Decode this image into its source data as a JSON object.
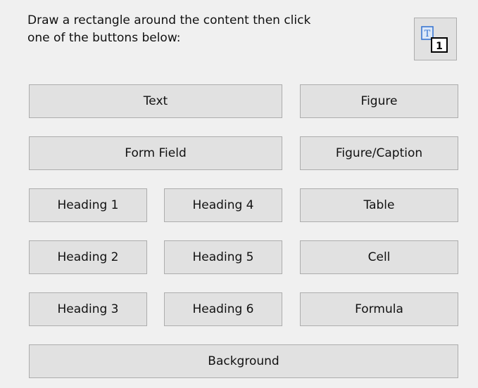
{
  "instructions": {
    "line1": "Draw a rectangle around the content then click",
    "line2": "one of the buttons below:"
  },
  "icons": {
    "reading_order": "reading-order-icon",
    "glyph_t": "T",
    "glyph_1": "1"
  },
  "buttons": {
    "text": "Text",
    "figure": "Figure",
    "form_field": "Form Field",
    "figure_caption": "Figure/Caption",
    "heading1": "Heading 1",
    "heading2": "Heading 2",
    "heading3": "Heading 3",
    "heading4": "Heading 4",
    "heading5": "Heading 5",
    "heading6": "Heading 6",
    "table": "Table",
    "cell": "Cell",
    "formula": "Formula",
    "background": "Background"
  },
  "colors": {
    "panel_bg": "#f0f0f0",
    "button_bg": "#e1e1e1",
    "button_border": "#adadad",
    "icon_blue": "#2f6fd0"
  }
}
